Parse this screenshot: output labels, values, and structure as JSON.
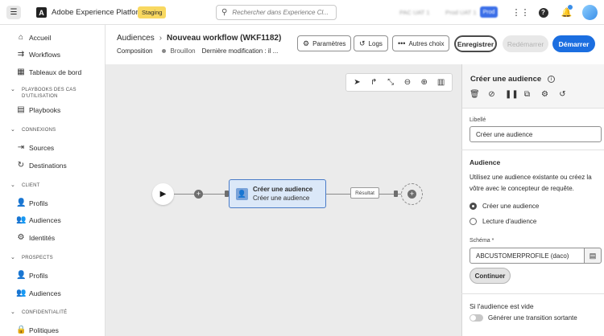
{
  "app": {
    "name": "Adobe Experience Platform",
    "sandbox": "Staging",
    "search_placeholder": "Rechercher dans Experience Cl...",
    "org_a": "PAC UAT 1",
    "org_b": "Prod UAT 1",
    "org_c": "Prod"
  },
  "sidebar": {
    "items_top": [
      {
        "label": "Accueil",
        "icon": "home-icon"
      },
      {
        "label": "Workflows",
        "icon": "workflow-icon"
      },
      {
        "label": "Tableaux de bord",
        "icon": "dashboard-icon"
      }
    ],
    "sec_playbooks": "PLAYBOOKS DES CAS D'UTILISATION",
    "playbooks": "Playbooks",
    "sec_connexions": "CONNEXIONS",
    "sources": "Sources",
    "destinations": "Destinations",
    "sec_client": "CLIENT",
    "profils": "Profils",
    "audiences": "Audiences",
    "identites": "Identités",
    "sec_prospects": "PROSPECTS",
    "prospect_profils": "Profils",
    "prospect_audiences": "Audiences",
    "sec_confidentialite": "CONFIDENTIALITÉ",
    "politiques": "Politiques"
  },
  "header": {
    "breadcrumb_parent": "Audiences",
    "breadcrumb_current": "Nouveau workflow (WKF1182)",
    "composition": "Composition",
    "status": "Brouillon",
    "modified": "Dernière modification : il ...",
    "btn_params": "Paramètres",
    "btn_logs": "Logs",
    "btn_more": "Autres choix",
    "btn_save": "Enregistrer",
    "btn_restart": "Redémarrer",
    "btn_start": "Démarrer"
  },
  "canvas": {
    "node_title": "Créer une audience",
    "node_sub": "Créer une audience",
    "result_label": "Résultat"
  },
  "panel": {
    "title": "Créer une audience",
    "label_caption": "Libellé",
    "label_value": "Créer une audience",
    "audience_heading": "Audience",
    "audience_desc": "Utilisez une audience existante ou créez la vôtre avec le concepteur de requête.",
    "radio_create": "Créer une audience",
    "radio_read": "Lecture d'audience",
    "schema_caption": "Schéma",
    "schema_required": "*",
    "schema_value": "ABCUSTOMERPROFILE (daco)",
    "continue": "Continuer",
    "empty_heading": "Si l'audience est vide",
    "toggle_label": "Générer une transition sortante"
  }
}
